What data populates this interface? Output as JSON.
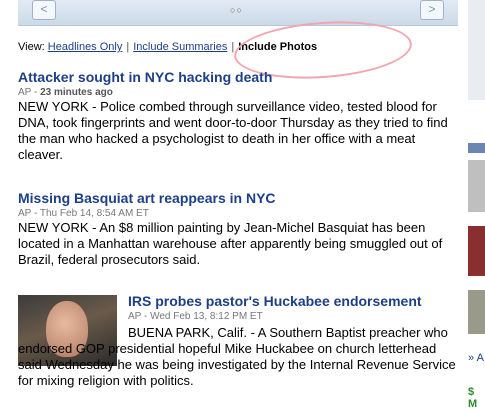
{
  "carousel": {
    "prev_label": "<",
    "next_label": ">",
    "page_indicator": "○○"
  },
  "view_switch": {
    "prefix": "View:",
    "options": [
      "Headlines Only",
      "Include Summaries"
    ],
    "selected": "Include Photos"
  },
  "stories": [
    {
      "headline": "Attacker sought in NYC hacking death",
      "source": "AP",
      "time": "23 minutes ago",
      "summary": "NEW YORK - Police combed through surveillance video, tested blood for DNA, took fingerprints and went door-to-door Thursday as they tried to find the man who hacked a psychologist to death in her office with a meat cleaver."
    },
    {
      "headline": "Missing Basquiat art reappears in NYC",
      "source": "AP",
      "time": "Thu Feb 14, 8:54 AM ET",
      "summary": "NEW YORK - An $8 million painting by Jean-Michel Basquiat has been located in a Manhattan warehouse after apparently being smuggled out of Brazil, federal prosecutors said."
    },
    {
      "headline": "IRS probes pastor's Huckabee endorsement",
      "source": "AP",
      "time": "Wed Feb 13, 8:12 PM ET",
      "summary": "BUENA PARK, Calif. - A Southern Baptist preacher who endorsed GOP presidential hopeful Mike Huckabee on church letterhead said Wednesday he was being investigated by the Internal Revenue Service for mixing religion with politics."
    }
  ],
  "rail": {
    "link_glyph": "» A",
    "dollar_glyph": "$ M"
  }
}
